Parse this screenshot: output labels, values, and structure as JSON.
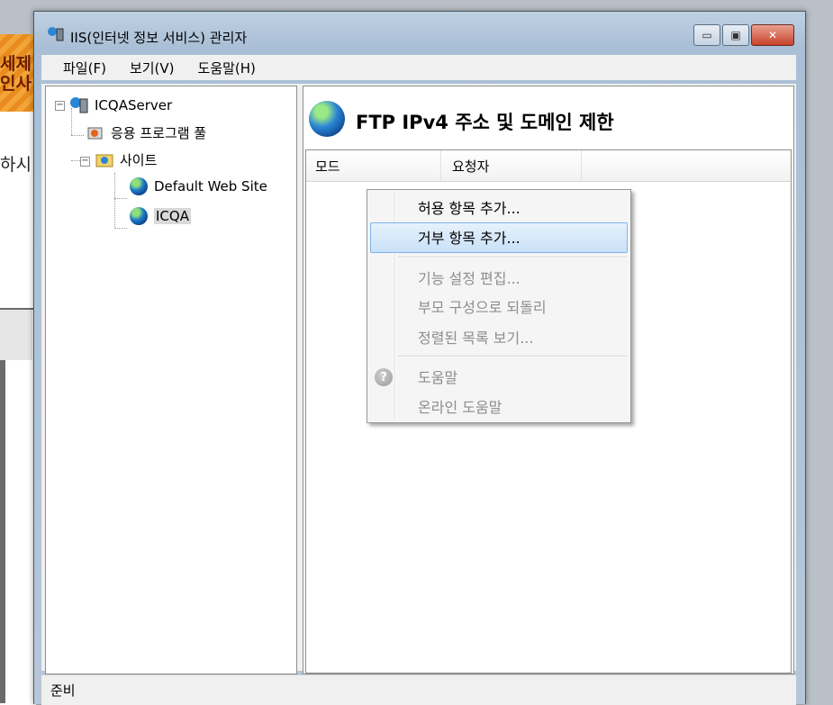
{
  "background": {
    "banner_text": "세제\n인사",
    "pane_text": "하시"
  },
  "window": {
    "title": "IIS(인터넷 정보 서비스) 관리자",
    "controls": {
      "minimize": "▭",
      "maximize": "▣",
      "close": "✕"
    }
  },
  "menu": [
    "파일(F)",
    "보기(V)",
    "도움말(H)"
  ],
  "tree": {
    "server": "ICQAServer",
    "app_pools": "응용 프로그램 풀",
    "sites": "사이트",
    "site_default": "Default Web Site",
    "site_icqa": "ICQA"
  },
  "feature": {
    "title": "FTP IPv4 주소 및 도메인 제한",
    "columns": [
      "모드",
      "요청자"
    ]
  },
  "context_menu": {
    "items": [
      {
        "label": "허용 항목 추가...",
        "enabled": true
      },
      {
        "label": "거부 항목 추가...",
        "enabled": true,
        "hover": true
      },
      {
        "label": "기능 설정 편집...",
        "enabled": false
      },
      {
        "label": "부모 구성으로 되돌리",
        "enabled": false
      },
      {
        "label": "정렬된 목록 보기...",
        "enabled": false
      },
      {
        "label": "도움말",
        "enabled": false
      },
      {
        "label": "온라인 도움말",
        "enabled": false
      }
    ]
  },
  "status": "준비",
  "colors": {
    "selection": "#c9e1f8",
    "selection_border": "#7eb4ea",
    "close_button": "#c8432b"
  }
}
